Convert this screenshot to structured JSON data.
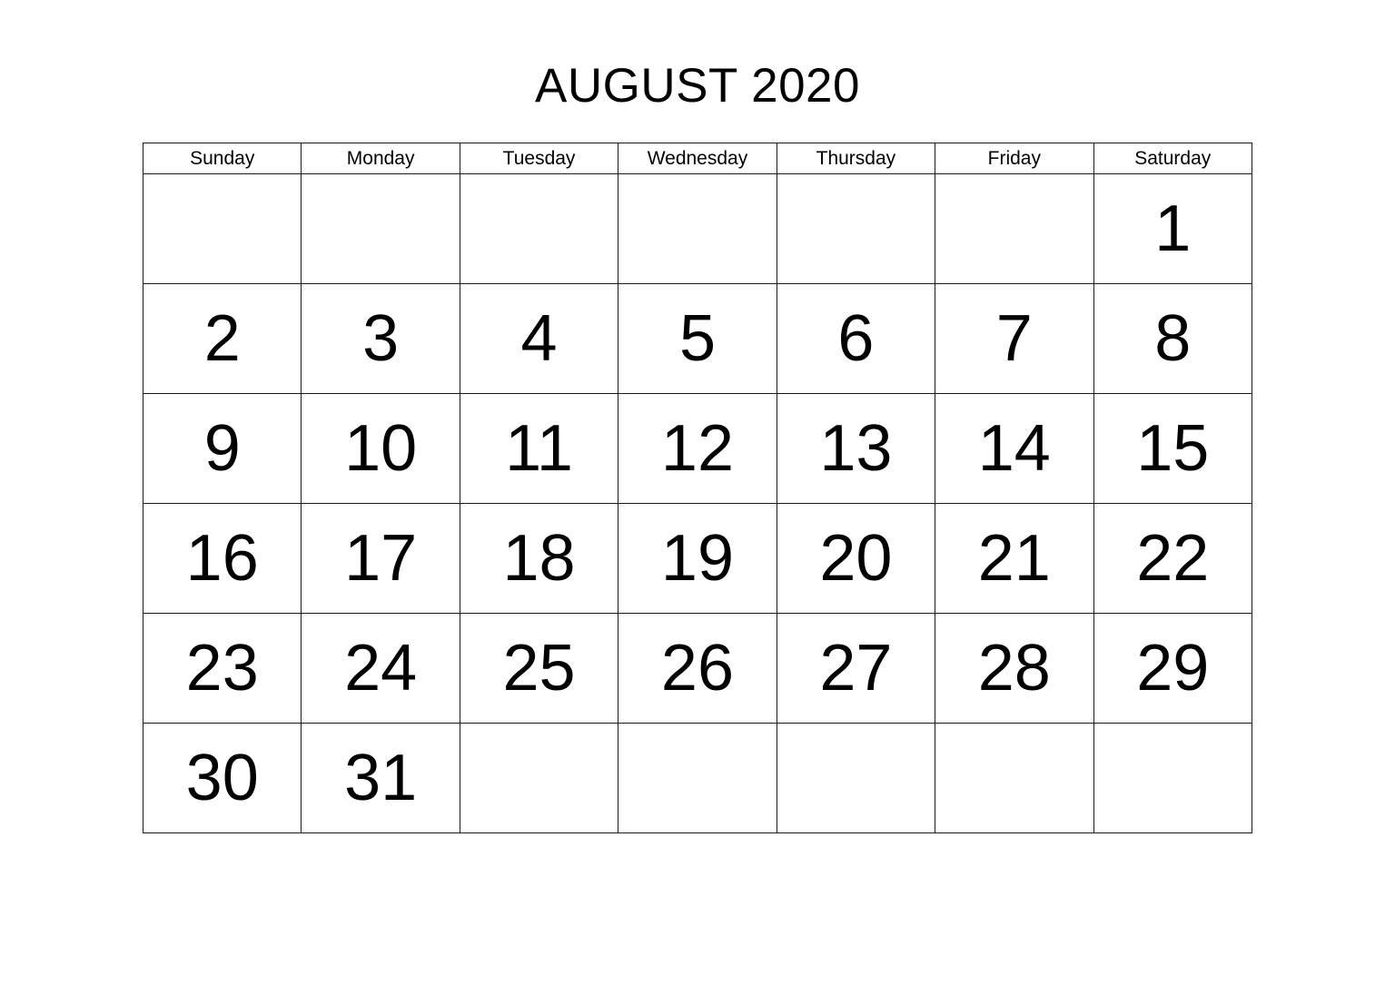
{
  "calendar": {
    "title": "AUGUST 2020",
    "month_name": "AUGUST",
    "year": "2020",
    "weekday_headers": [
      "Sunday",
      "Monday",
      "Tuesday",
      "Wednesday",
      "Thursday",
      "Friday",
      "Saturday"
    ],
    "weeks": [
      [
        "",
        "",
        "",
        "",
        "",
        "",
        "1"
      ],
      [
        "2",
        "3",
        "4",
        "5",
        "6",
        "7",
        "8"
      ],
      [
        "9",
        "10",
        "11",
        "12",
        "13",
        "14",
        "15"
      ],
      [
        "16",
        "17",
        "18",
        "19",
        "20",
        "21",
        "22"
      ],
      [
        "23",
        "24",
        "25",
        "26",
        "27",
        "28",
        "29"
      ],
      [
        "30",
        "31",
        "",
        "",
        "",
        "",
        ""
      ]
    ],
    "colors": {
      "text": "#000000",
      "border": "#1a1a1a",
      "background": "#ffffff"
    }
  }
}
